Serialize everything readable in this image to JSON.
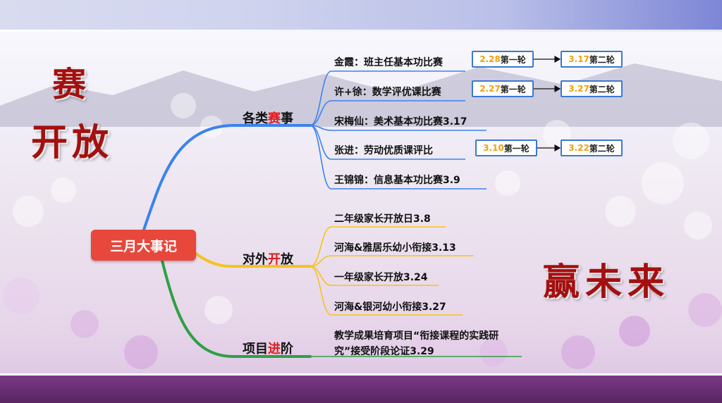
{
  "left_callig": {
    "char1": "赛",
    "char2": "开放"
  },
  "right_callig": "赢未来",
  "root": "三月大事记",
  "branches": [
    {
      "prefix": "各类",
      "highlight": "赛",
      "suffix": "事"
    },
    {
      "prefix": "对外",
      "highlight": "开",
      "suffix": "放"
    },
    {
      "prefix": "项目",
      "highlight": "进",
      "suffix": "阶"
    }
  ],
  "leaves": [
    "金霞：班主任基本功比赛",
    "许+徐：数学评优课比赛",
    "宋梅仙：美术基本功比赛3.17",
    "张进：劳动优质课评比",
    "王锦锦：信息基本功比赛3.9",
    "二年级家长开放日3.8",
    "河海&雅居乐幼小衔接3.13",
    "一年级家长开放3.24",
    "河海&银河幼小衔接3.27",
    "教学成果培育项目“衔接课程的实践研究”接受阶段论证3.29"
  ],
  "rounds": {
    "r1a": {
      "date": "2.28",
      "label": "第一轮"
    },
    "r1b": {
      "date": "3.17",
      "label": "第二轮"
    },
    "r2a": {
      "date": "2.27",
      "label": "第一轮"
    },
    "r2b": {
      "date": "3.27",
      "label": "第二轮"
    },
    "r4a": {
      "date": "3.10",
      "label": "第一轮"
    },
    "r4b": {
      "date": "3.22",
      "label": "第二轮"
    }
  },
  "colors": {
    "branch_blue": "#3b82f0",
    "branch_yellow": "#f7c21a",
    "branch_green": "#2ea043",
    "highlight_red": "#e11b1b",
    "root_red": "#e8473c",
    "callig_red": "#a3100f",
    "round_border": "#3a78d4",
    "date_orange": "#f0a10a"
  }
}
